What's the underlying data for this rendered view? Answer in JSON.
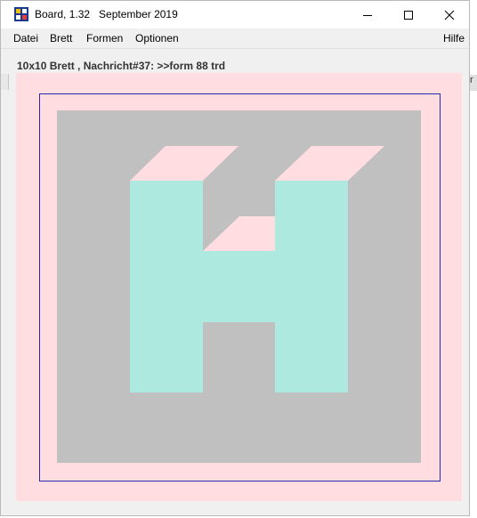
{
  "window": {
    "title": "Board, 1.32   September 2019",
    "icon": "board-app-icon",
    "controls": [
      "minimize-icon",
      "maximize-icon",
      "close-icon"
    ]
  },
  "menu": {
    "items": [
      "Datei",
      "Brett",
      "Formen",
      "Optionen"
    ],
    "help": "Hilfe"
  },
  "status": {
    "text": "10x10 Brett , Nachricht#37: >>form 88 trd"
  },
  "board": {
    "letter": "H",
    "colors": {
      "outer": "#ffdde1",
      "frame": "#2a2aa8",
      "background": "#c0c0c0",
      "front": "#ade9de",
      "top": "#ffdde1"
    }
  },
  "edge_right_text": "r"
}
